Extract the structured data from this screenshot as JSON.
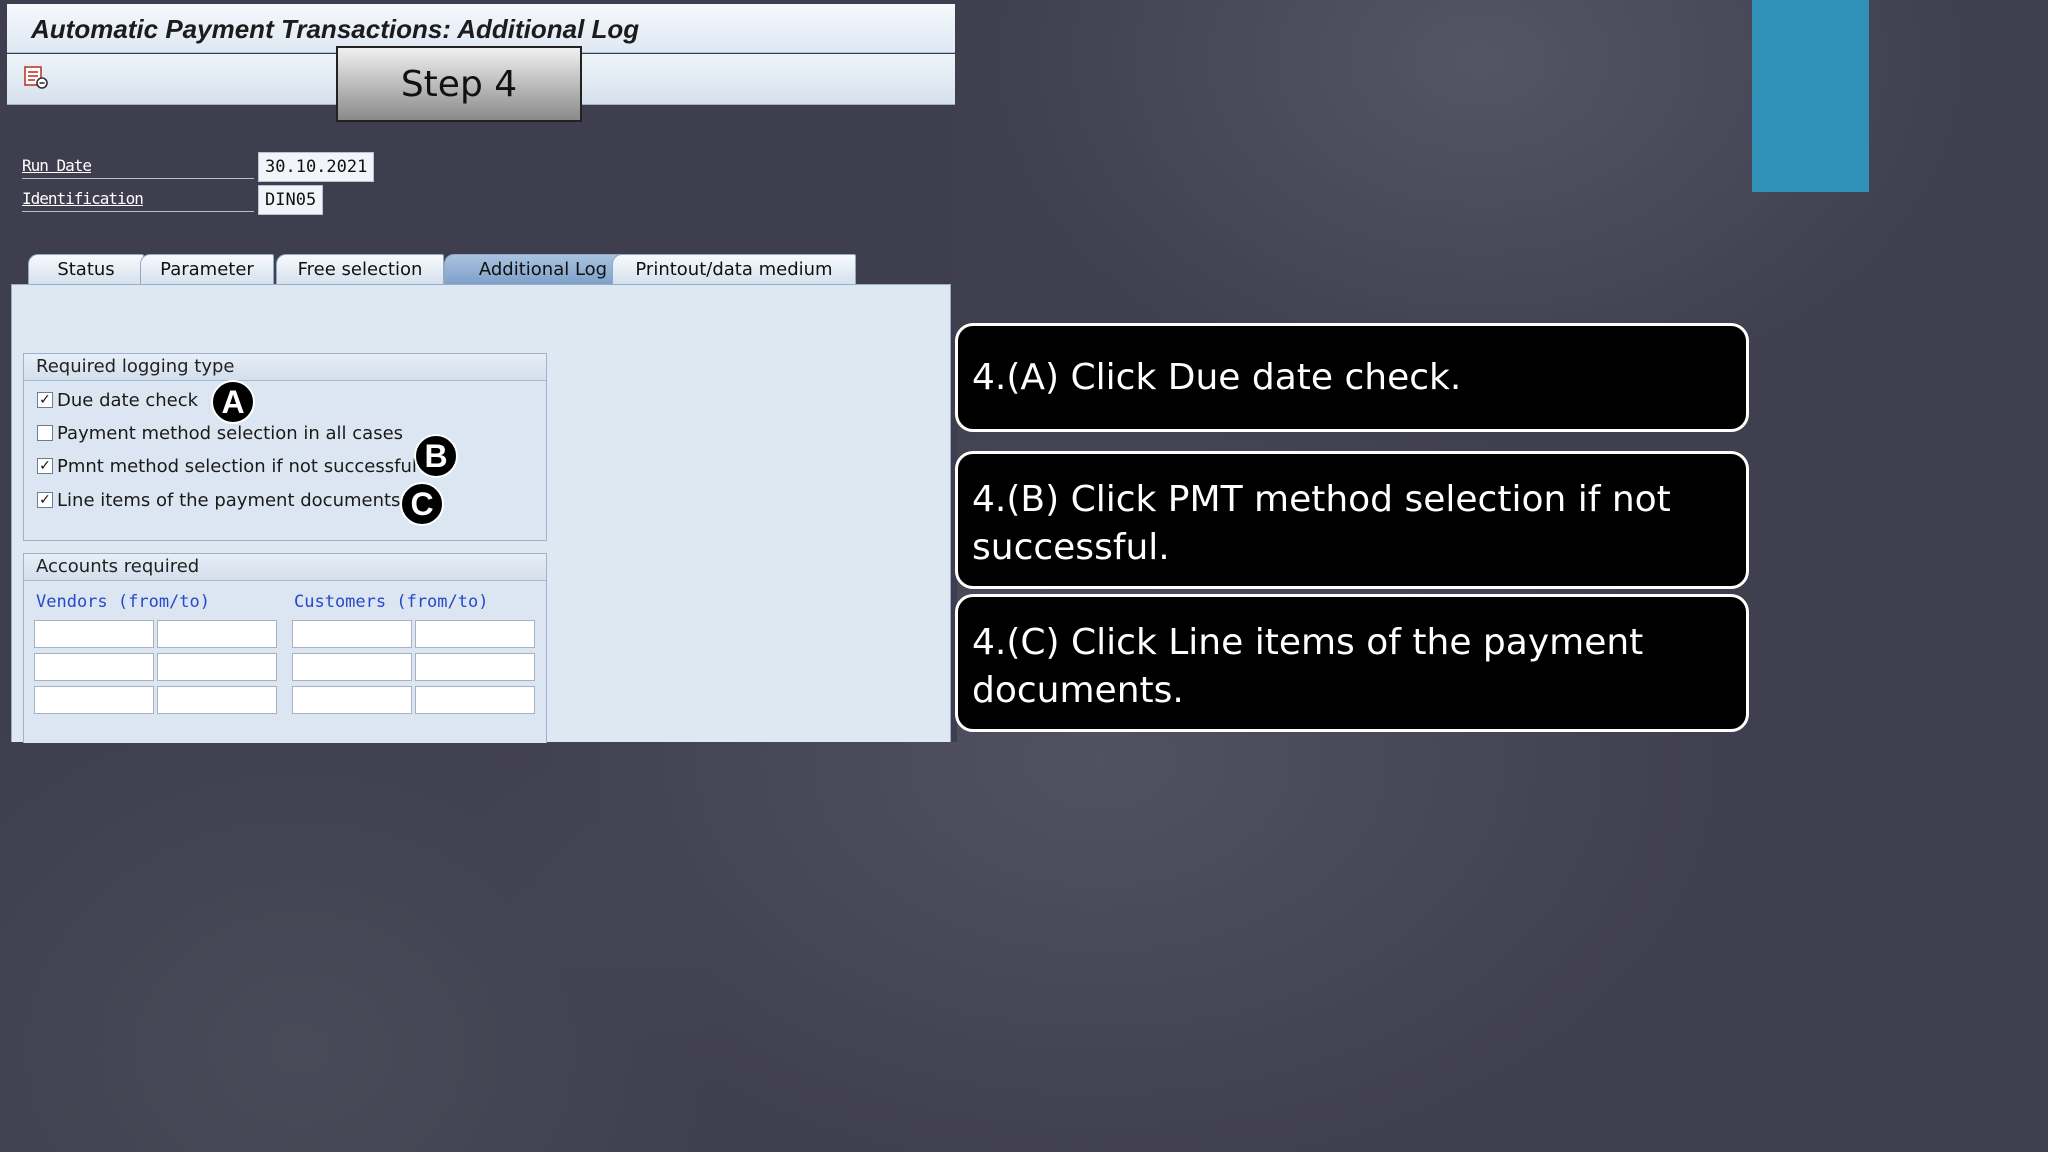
{
  "window": {
    "title": "Automatic Payment Transactions: Additional Log",
    "step_label": "Step 4"
  },
  "header_fields": [
    {
      "label": "Run Date",
      "value": "30.10.2021"
    },
    {
      "label": "Identification",
      "value": "DIN05"
    }
  ],
  "tabs": [
    {
      "label": "Status",
      "active": false
    },
    {
      "label": "Parameter",
      "active": false
    },
    {
      "label": "Free selection",
      "active": false
    },
    {
      "label": "Additional Log",
      "active": true
    },
    {
      "label": "Printout/data medium",
      "active": false
    }
  ],
  "logging_group": {
    "title": "Required logging type",
    "options": [
      {
        "label": "Due date check",
        "checked": true,
        "marker": "A"
      },
      {
        "label": "Payment method selection in all cases",
        "checked": false,
        "marker": ""
      },
      {
        "label": "Pmnt method selection if not successful",
        "checked": true,
        "marker": "B"
      },
      {
        "label": "Line items of the payment documents",
        "checked": true,
        "marker": "C"
      }
    ]
  },
  "accounts_group": {
    "title": "Accounts required",
    "vendors_label": "Vendors (from/to)",
    "customers_label": "Customers (from/to)"
  },
  "callouts": [
    "4.(A) Click Due date check.",
    "4.(B) Click PMT method selection if not successful.",
    "4.(C) Click Line items of the payment documents."
  ],
  "icons": {
    "toolbar": "log-list-icon",
    "check": "✓"
  },
  "colors": {
    "accent": "#2f91b8",
    "background": "#403f4f",
    "active_tab": "#8fb0d6",
    "column_header": "#2748c8"
  }
}
